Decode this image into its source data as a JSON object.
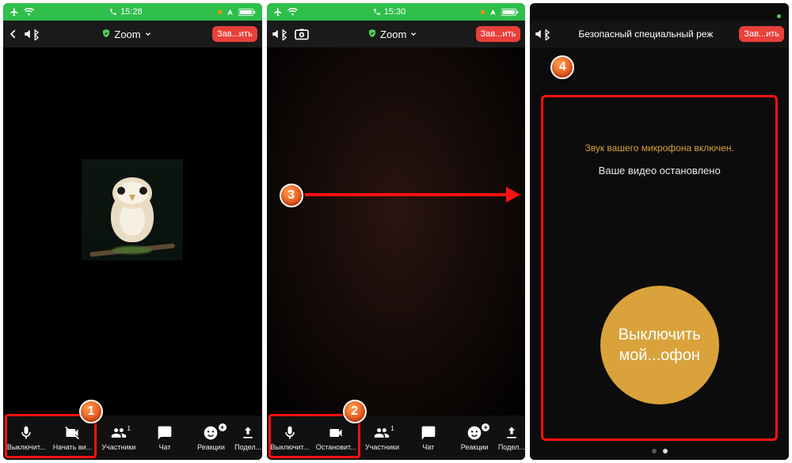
{
  "status": {
    "time1": "15:28",
    "time2": "15:30"
  },
  "topbar": {
    "title_zoom": "Zoom",
    "title_safe": "Безопасный специальный реж",
    "end_label": "Зав...ить"
  },
  "toolbar": {
    "mic": "Выключит...",
    "video_start": "Начать ви...",
    "video_stop": "Остановит...",
    "participants": "Участники",
    "participants_count": "1",
    "chat": "Чат",
    "reactions": "Реакции",
    "share": "Подел..."
  },
  "safe": {
    "mic_on": "Звук вашего микрофона включен.",
    "video_stopped": "Ваше видео остановлено",
    "mute_line1": "Выключить",
    "mute_line2": "мой...офон"
  },
  "callouts": {
    "c1": "1",
    "c2": "2",
    "c3": "3",
    "c4": "4"
  }
}
